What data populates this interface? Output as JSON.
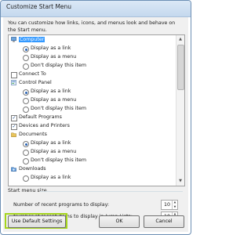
{
  "window": {
    "title": "Customize Start Menu"
  },
  "intro": "You can customize how links, icons, and menus look and behave on the Start menu.",
  "items": [
    {
      "kind": "icon",
      "label": "Computer",
      "selected": true,
      "icon": "computer-icon"
    },
    {
      "kind": "radio",
      "label": "Display as a link",
      "checked": true
    },
    {
      "kind": "radio",
      "label": "Display as a menu",
      "checked": false
    },
    {
      "kind": "radio",
      "label": "Don't display this item",
      "checked": false
    },
    {
      "kind": "check",
      "label": "Connect To",
      "checked": false
    },
    {
      "kind": "icon",
      "label": "Control Panel",
      "icon": "control-panel-icon"
    },
    {
      "kind": "radio",
      "label": "Display as a link",
      "checked": true
    },
    {
      "kind": "radio",
      "label": "Display as a menu",
      "checked": false
    },
    {
      "kind": "radio",
      "label": "Don't display this item",
      "checked": false
    },
    {
      "kind": "check",
      "label": "Default Programs",
      "checked": true
    },
    {
      "kind": "check",
      "label": "Devices and Printers",
      "checked": true
    },
    {
      "kind": "icon",
      "label": "Documents",
      "icon": "documents-icon"
    },
    {
      "kind": "radio",
      "label": "Display as a link",
      "checked": true
    },
    {
      "kind": "radio",
      "label": "Display as a menu",
      "checked": false
    },
    {
      "kind": "radio",
      "label": "Don't display this item",
      "checked": false
    },
    {
      "kind": "icon",
      "label": "Downloads",
      "icon": "downloads-icon"
    },
    {
      "kind": "radio",
      "label": "Display as a link",
      "checked": false
    }
  ],
  "start_menu_size": {
    "heading": "Start menu size",
    "recent_programs_label": "Number of recent programs to display:",
    "recent_programs_value": "10",
    "jump_list_label": "Number of recent items to display in Jump Lists:",
    "jump_list_value": "10"
  },
  "buttons": {
    "defaults": "Use Default Settings",
    "ok": "OK",
    "cancel": "Cancel"
  },
  "colors": {
    "highlight": "#a4d41c",
    "selection": "#3399ff"
  }
}
